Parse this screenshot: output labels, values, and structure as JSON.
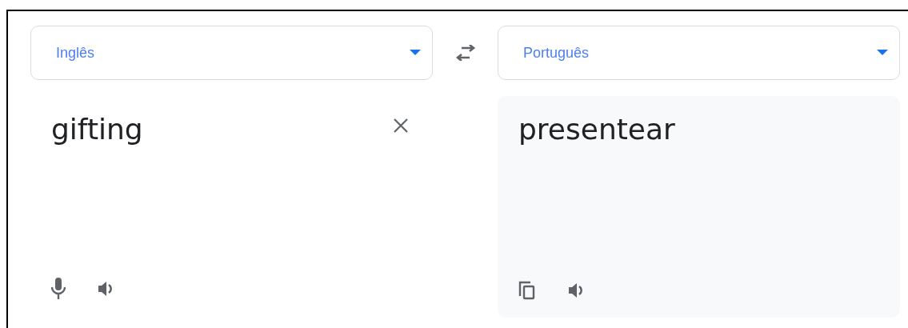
{
  "source": {
    "language": "Inglês",
    "text": "gifting"
  },
  "target": {
    "language": "Português",
    "text": "presentear"
  }
}
